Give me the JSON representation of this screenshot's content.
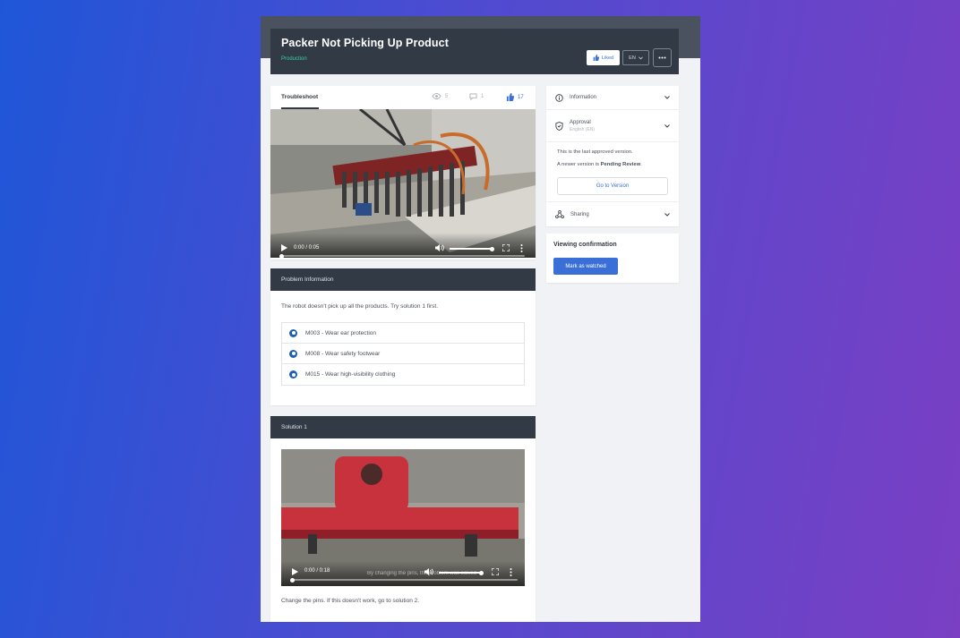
{
  "header": {
    "title": "Packer Not Picking Up Product",
    "category": "Production",
    "liked_label": "Liked",
    "language": "EN"
  },
  "main": {
    "tab_label": "Troubleshoot",
    "views": "5",
    "comments": "1",
    "likes": "17",
    "video": {
      "time": "0:00 / 0:05"
    }
  },
  "problem": {
    "heading": "Problem Information",
    "description": "The robot doesn't pick up all the products. Try solution 1 first.",
    "safety_items": [
      {
        "label": "M003 - Wear ear protection",
        "icon": "ear-protection-icon"
      },
      {
        "label": "M008 - Wear safety footwear",
        "icon": "safety-footwear-icon"
      },
      {
        "label": "M015 - Wear high-visibility clothing",
        "icon": "hivis-clothing-icon"
      }
    ]
  },
  "solution": {
    "heading": "Solution 1",
    "video": {
      "time": "0:00 / 0:18",
      "caption": "By changing the pins, the problem was solved"
    },
    "description": "Change the pins. If this doesn't work, go to solution 2."
  },
  "sidebar": {
    "information_label": "Information",
    "approval_label": "Approval",
    "approval_sub": "English (EN)",
    "approval_text_1": "This is the last approved version.",
    "approval_text_2_prefix": "A newer version is ",
    "approval_text_2_status": "Pending Review",
    "approval_text_2_suffix": ".",
    "goto_label": "Go to Version",
    "sharing_label": "Sharing"
  },
  "confirmation": {
    "title": "Viewing confirmation",
    "button_label": "Mark as watched"
  },
  "colors": {
    "accent": "#3b6fd8",
    "header": "#323a46",
    "category": "#35d1a4"
  }
}
